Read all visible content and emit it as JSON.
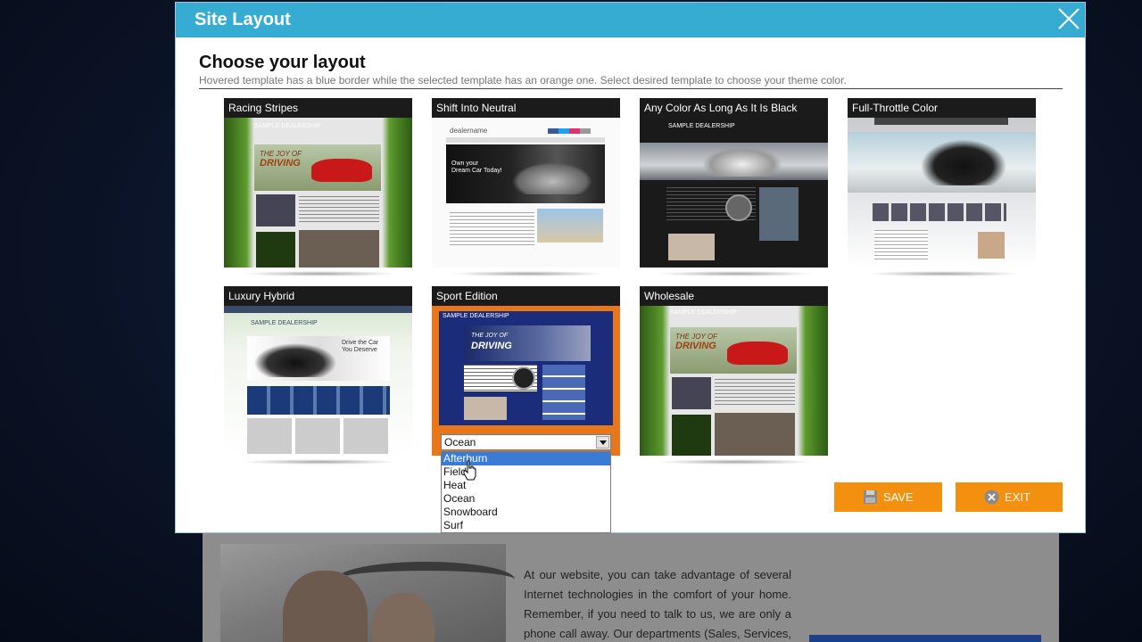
{
  "modal": {
    "title": "Site Layout",
    "heading": "Choose your layout",
    "subheading": "Hovered template has a blue border while the selected template has an orange one. Select desired template to choose your theme color."
  },
  "templates": [
    {
      "label": "Racing Stripes"
    },
    {
      "label": "Shift Into Neutral"
    },
    {
      "label": "Any Color As Long As It Is Black"
    },
    {
      "label": "Full-Throttle Color"
    },
    {
      "label": "Luxury Hybrid"
    },
    {
      "label": "Sport Edition",
      "selected": true
    },
    {
      "label": "Wholesale"
    }
  ],
  "thumbnail_text": {
    "dealership": "SAMPLE DEALERSHIP",
    "dealer": "dealername",
    "joy_line1": "THE JOY OF",
    "joy_line2": "DRIVING",
    "dream_line1": "Own your",
    "dream_line2": "Dream Car Today!",
    "lux_line1": "Drive the Car",
    "lux_line2": "You Deserve"
  },
  "theme_select": {
    "value": "Ocean",
    "options": [
      "Afterburn",
      "Field",
      "Heat",
      "Ocean",
      "Snowboard",
      "Surf"
    ],
    "highlighted": "Afterburn"
  },
  "buttons": {
    "save": "SAVE",
    "exit": "EXIT"
  },
  "background_page": {
    "text": "At our website, you can take advantage of several Internet technologies in the comfort of your home. Remember, if you need to talk to us, we are only a phone call away. Our departments (Sales, Services, and"
  },
  "colors": {
    "header": "#37acd3",
    "accent_orange": "#f3900f",
    "selected_border": "#e8761a",
    "highlight": "#3a7bd5"
  }
}
